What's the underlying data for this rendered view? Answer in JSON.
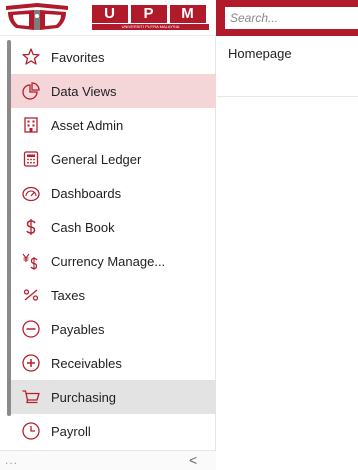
{
  "brand": {
    "name": [
      "U",
      "P",
      "M"
    ],
    "subtitle": "UNIVERSITI PUTRA MALAYSIA",
    "accent_color": "#b01a2b"
  },
  "search": {
    "placeholder": "Search..."
  },
  "sidebar": {
    "items": [
      {
        "label": "Favorites",
        "icon": "star-icon"
      },
      {
        "label": "Data Views",
        "icon": "pie-chart-icon",
        "state": "highlighted"
      },
      {
        "label": "Asset Admin",
        "icon": "building-icon"
      },
      {
        "label": "General Ledger",
        "icon": "calculator-icon"
      },
      {
        "label": "Dashboards",
        "icon": "gauge-icon"
      },
      {
        "label": "Cash Book",
        "icon": "dollar-icon"
      },
      {
        "label": "Currency Manage...",
        "icon": "currency-icon"
      },
      {
        "label": "Taxes",
        "icon": "percent-icon"
      },
      {
        "label": "Payables",
        "icon": "minus-circle-icon"
      },
      {
        "label": "Receivables",
        "icon": "plus-circle-icon"
      },
      {
        "label": "Purchasing",
        "icon": "cart-icon",
        "state": "selected"
      },
      {
        "label": "Payroll",
        "icon": "clock-icon"
      }
    ],
    "footer": {
      "more": "...",
      "collapse": "<"
    }
  },
  "main": {
    "title": "Homepage"
  }
}
